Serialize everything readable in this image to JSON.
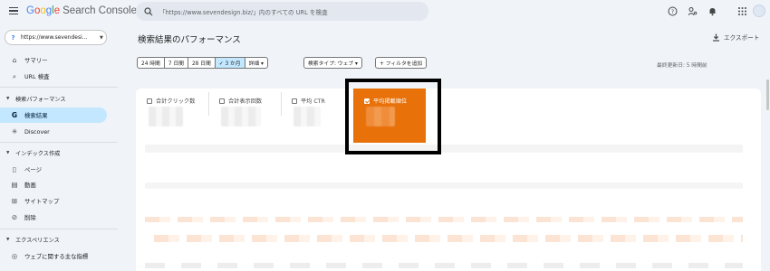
{
  "header": {
    "logo": {
      "g": "G",
      "o1": "o",
      "o2": "o",
      "g2": "g",
      "l": "l",
      "e": "e",
      "product": "Search Console"
    },
    "search_placeholder": "「https://www.sevendesign.biz/」内のすべての URL を検査",
    "icons": [
      "menu-icon",
      "search-icon",
      "help-icon",
      "manage-accounts-icon",
      "bell-icon",
      "apps-grid-icon",
      "avatar"
    ]
  },
  "sidebar": {
    "property": "https://www.sevendesi...",
    "items_top": [
      {
        "icon": "⌂",
        "label": "サマリー"
      },
      {
        "icon": "⌕",
        "label": "URL 検査"
      }
    ],
    "section_performance": "検索パフォーマンス",
    "items_performance": [
      {
        "icon": "G",
        "label": "検索結果"
      },
      {
        "icon": "✳",
        "label": "Discover"
      }
    ],
    "section_index": "インデックス作成",
    "items_index": [
      {
        "icon": "▯",
        "label": "ページ"
      },
      {
        "icon": "▤",
        "label": "動画"
      },
      {
        "icon": "⊞",
        "label": "サイトマップ"
      },
      {
        "icon": "⊘",
        "label": "削除"
      }
    ],
    "section_experience": "エクスペリエンス",
    "items_experience": [
      {
        "icon": "◎",
        "label": "ウェブに関する主な指標"
      }
    ]
  },
  "main": {
    "title": "検索結果のパフォーマンス",
    "export_label": "エクスポート",
    "date_chips": [
      "24 時間",
      "7 日間",
      "28 日間",
      "✓ 3 か月",
      "詳細 ▾"
    ],
    "search_type_chip": "検索タイプ: ウェブ ▾",
    "add_filter_chip": "+ フィルタを追加",
    "last_updated": "最終更新日: 5 時間前",
    "metrics": [
      {
        "label": "合計クリック数",
        "checked": false
      },
      {
        "label": "合計表示回数",
        "checked": false
      },
      {
        "label": "平均 CTR",
        "checked": false
      },
      {
        "label": "平均掲載順位",
        "checked": true
      }
    ]
  },
  "colors": {
    "accent_selected_metric": "#e8710a",
    "nav_active": "#c2e7ff",
    "background": "#f0f4f9",
    "highlight_border": "#000000"
  }
}
